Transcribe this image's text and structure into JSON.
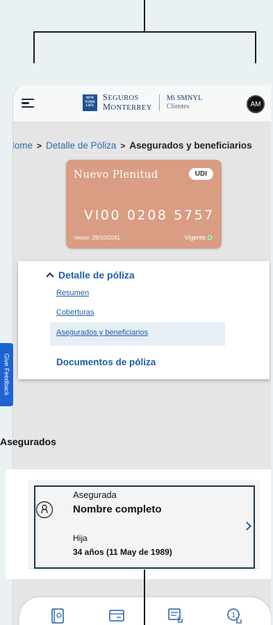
{
  "header": {
    "brand_logo_text": "NEW YORK LIFE",
    "brand_line1": "Seguros",
    "brand_line2": "Monterrey",
    "app_line1": "Mi SMNYL",
    "app_line2": "Clientes",
    "avatar_initials": "AM"
  },
  "breadcrumb": {
    "home": "Home",
    "separator": ">",
    "policy_detail": "Detalle de Póliza",
    "current": "Asegurados y beneficiarios"
  },
  "policy_card": {
    "plan_name": "Nuevo Plenitud",
    "currency_badge": "UDI",
    "policy_number": "VI00 0208 5757",
    "expires": "Vence: 28/10/2041",
    "status": "Vigente",
    "color": "#d99d83"
  },
  "detail_menu": {
    "section_title": "Detalle de póliza",
    "items": [
      {
        "label": "Resumen"
      },
      {
        "label": "Coberturas"
      },
      {
        "label": "Asegurados y beneficiarios"
      }
    ],
    "documents_label": "Documentos de póliza"
  },
  "feedback_tab": {
    "label": "Give Feedback"
  },
  "insured_section": {
    "heading": "Asegurados",
    "card": {
      "role": "Asegurada",
      "name": "Nombre completo",
      "relationship": "Hija",
      "age": "34 años (11 May de 1989)"
    }
  },
  "bottom_nav": {
    "icons": [
      "policy-book-icon",
      "card-payment-icon",
      "document-touch-icon",
      "number-one-touch-icon"
    ]
  },
  "colors": {
    "link": "#1f5ea8",
    "accent": "#1f63d3",
    "status_green": "#3fd26b"
  }
}
